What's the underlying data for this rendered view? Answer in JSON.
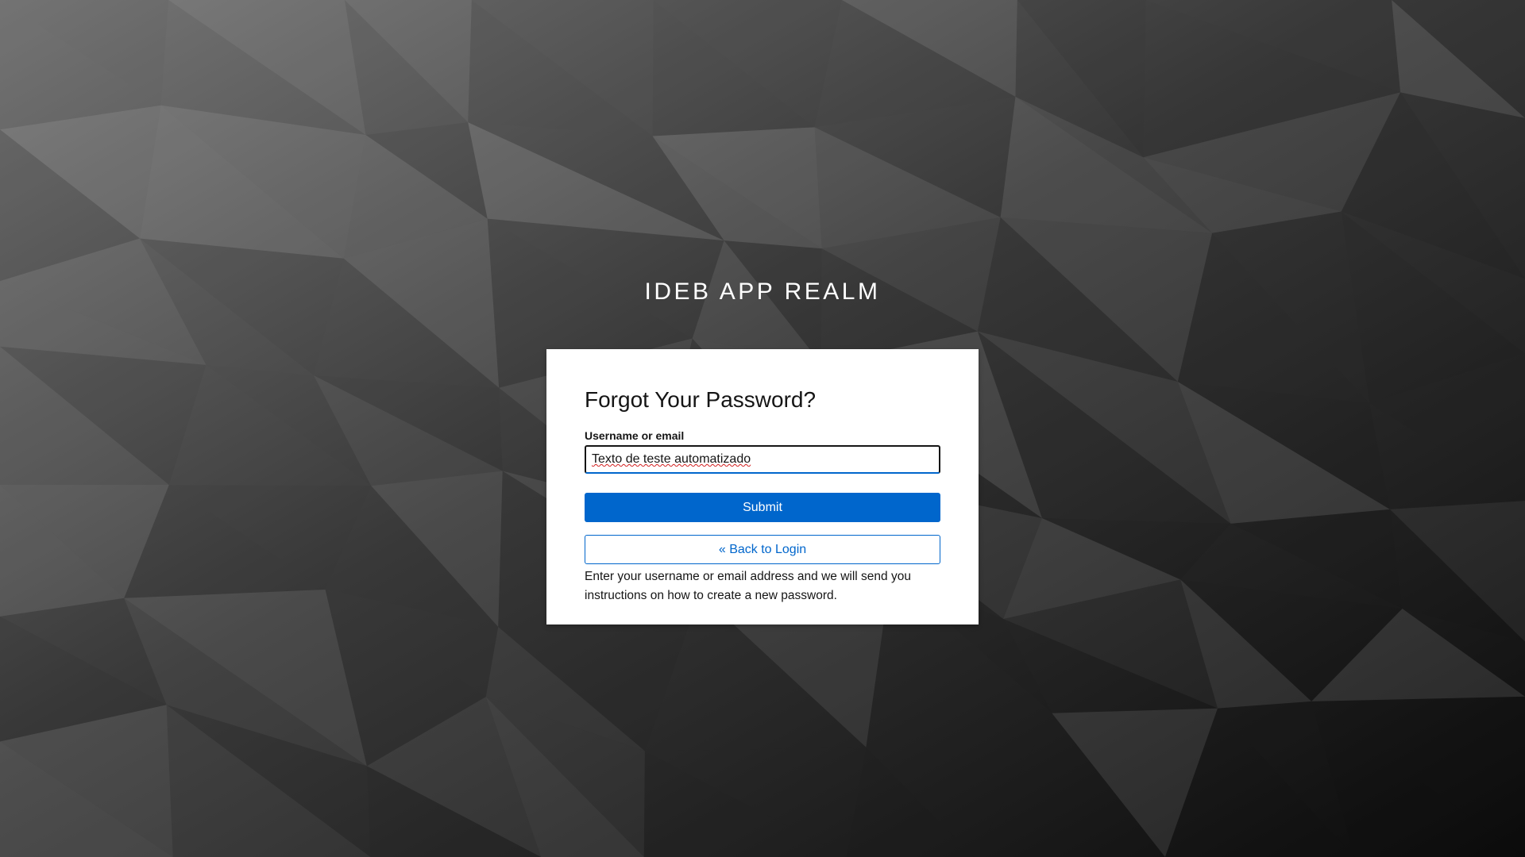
{
  "realm": {
    "title": "IDEB APP REALM"
  },
  "form": {
    "heading": "Forgot Your Password?",
    "username_label": "Username or email",
    "username_value": "Texto de teste automatizado",
    "submit_label": "Submit",
    "back_label": "« Back to Login",
    "info_text": "Enter your username or email address and we will send you instructions on how to create a new password."
  },
  "colors": {
    "primary": "#0066cc",
    "background_dark": "#1a1a1a",
    "background_light": "#7a7a7a",
    "card": "#ffffff"
  }
}
